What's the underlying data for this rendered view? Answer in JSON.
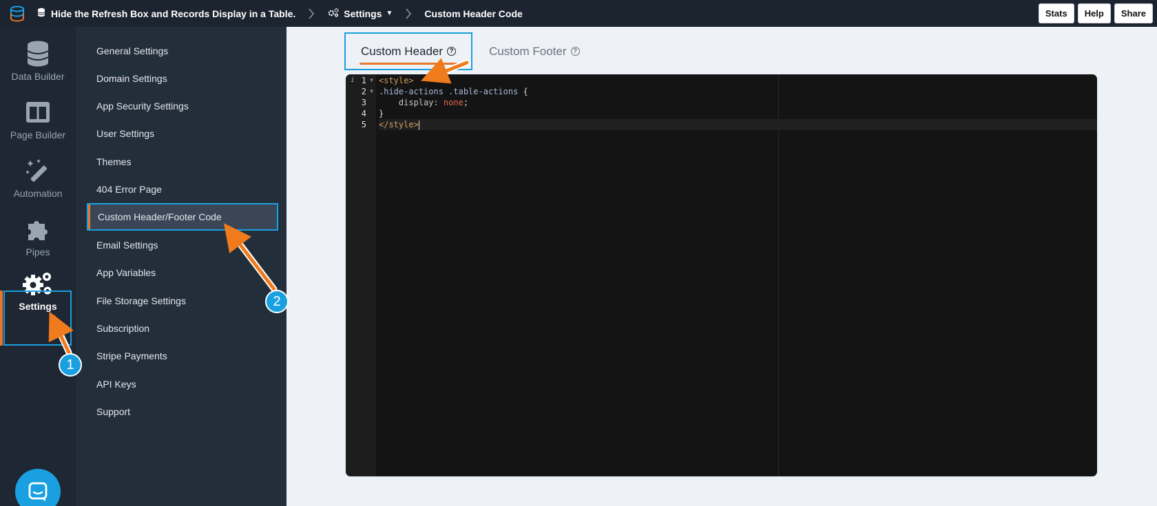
{
  "topbar": {
    "app_title": "Hide the Refresh Box and Records Display in a Table.",
    "settings_label": "Settings",
    "current_page": "Custom Header Code",
    "buttons": [
      "Stats",
      "Help",
      "Share"
    ]
  },
  "rail": {
    "items": [
      {
        "label": "Data Builder",
        "icon": "database-icon"
      },
      {
        "label": "Page Builder",
        "icon": "columns-icon"
      },
      {
        "label": "Automation",
        "icon": "magic-wand-icon"
      },
      {
        "label": "Pipes",
        "icon": "puzzle-icon"
      },
      {
        "label": "Settings",
        "icon": "gears-icon"
      }
    ],
    "active": "Settings"
  },
  "menu": {
    "items": [
      "General Settings",
      "Domain Settings",
      "App Security Settings",
      "User Settings",
      "Themes",
      "404 Error Page",
      "Custom Header/Footer Code",
      "Email Settings",
      "App Variables",
      "File Storage Settings",
      "Subscription",
      "Stripe Payments",
      "API Keys",
      "Support"
    ],
    "selected": "Custom Header/Footer Code"
  },
  "tabs": {
    "header": "Custom Header",
    "footer": "Custom Footer",
    "help_glyph": "?"
  },
  "editor": {
    "line_numbers": [
      "1",
      "2",
      "3",
      "4",
      "5"
    ],
    "lines": {
      "l1_tag": "<style>",
      "l2_sel1": ".hide-actions",
      "l2_sel2": ".table-actions",
      "l2_brace": " {",
      "l3_prop": "    display:",
      "l3_val": " none",
      "l3_end": ";",
      "l4": "}",
      "l5_tag": "</style>"
    }
  },
  "annotations": {
    "badge1": "1",
    "badge2": "2"
  },
  "colors": {
    "accent": "#1aa0e0",
    "arrow": "#f07b1c",
    "sidebar": "#1e2733"
  }
}
